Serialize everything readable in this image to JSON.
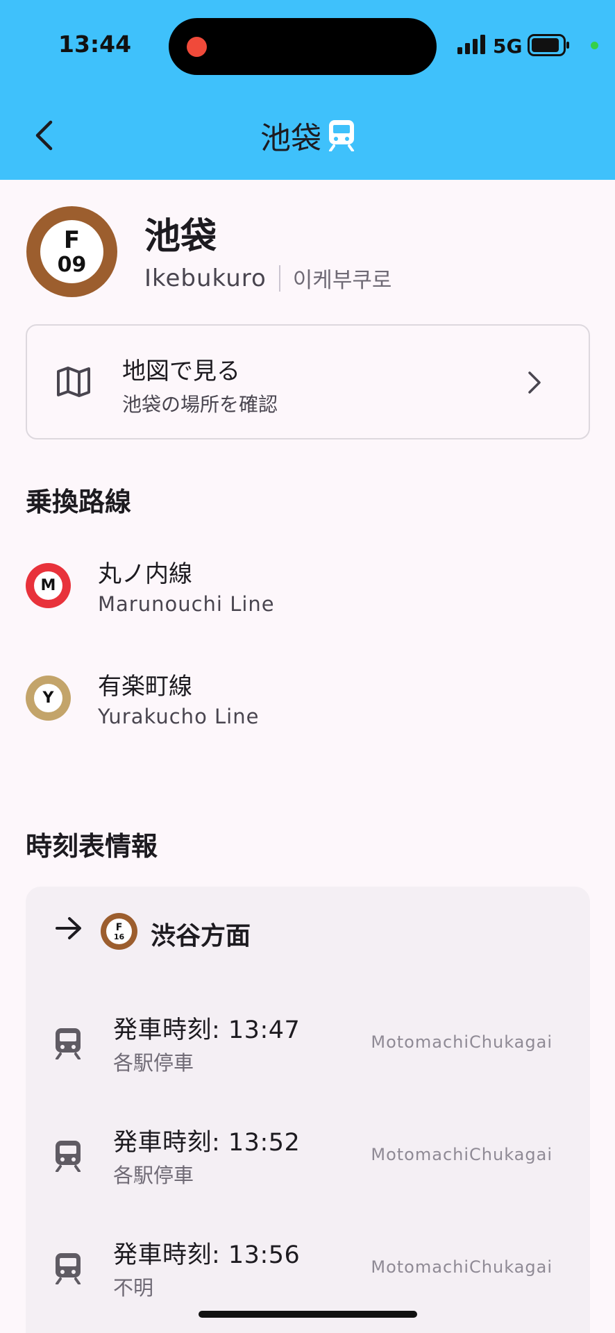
{
  "status_bar": {
    "time": "13:44",
    "network": "5G",
    "icons": [
      "signal-icon",
      "battery-icon"
    ]
  },
  "app_bar": {
    "title": "池袋",
    "back_icon": "chevron-left-icon",
    "title_icon": "train-icon"
  },
  "station": {
    "line_letter": "F",
    "number": "09",
    "badge_color": "#9c5e2e",
    "name_ja": "池袋",
    "name_en": "Ikebukuro",
    "name_ko": "이케부쿠로"
  },
  "map_card": {
    "icon": "map-icon",
    "title": "地図で見る",
    "subtitle": "池袋の場所を確認"
  },
  "transfer": {
    "heading": "乗換路線",
    "lines": [
      {
        "letter": "M",
        "name_ja": "丸ノ内線",
        "name_en": "Marunouchi Line",
        "color": "#e8323b"
      },
      {
        "letter": "Y",
        "name_ja": "有楽町線",
        "name_en": "Yurakucho Line",
        "color": "#c3a46a"
      }
    ]
  },
  "timetable": {
    "heading": "時刻表情報",
    "direction": {
      "line_letter": "F",
      "number": "16",
      "title": "渋谷方面"
    },
    "departures": [
      {
        "time": "発車時刻: 13:47",
        "type": "各駅停車",
        "destination": "MotomachiChukagai"
      },
      {
        "time": "発車時刻: 13:52",
        "type": "各駅停車",
        "destination": "MotomachiChukagai"
      },
      {
        "time": "発車時刻: 13:56",
        "type": "不明",
        "destination": "MotomachiChukagai"
      }
    ]
  }
}
